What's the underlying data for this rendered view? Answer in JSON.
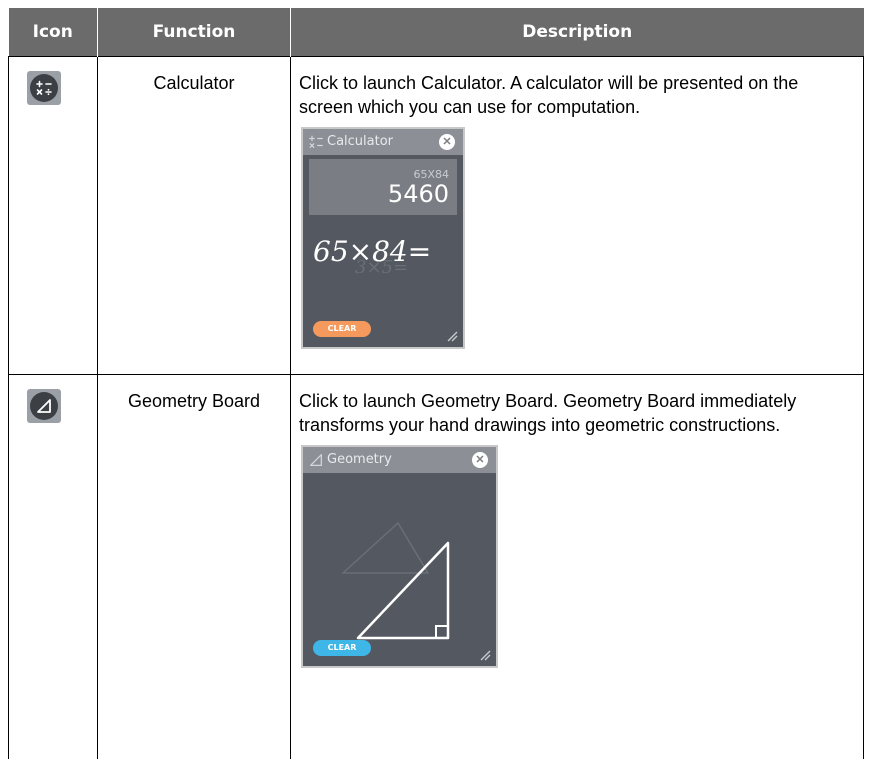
{
  "table": {
    "headers": {
      "icon": "Icon",
      "function": "Function",
      "description": "Description"
    },
    "rows": [
      {
        "icon": "calculator-icon",
        "function": "Calculator",
        "description": "Click to launch Calculator. A calculator will be presented on the screen which you can use for computation.",
        "screenshot": {
          "title": "Calculator",
          "expression": "65X84",
          "result": "5460",
          "handwriting": "65×84=",
          "faint_handwriting": "3×5=",
          "clear_label": "CLEAR",
          "clear_color": "#f59a5c"
        }
      },
      {
        "icon": "geometry-icon",
        "function": "Geometry Board",
        "description": "Click to launch Geometry Board. Geometry Board immediately transforms your hand drawings into geometric constructions.",
        "screenshot": {
          "title": "Geometry",
          "clear_label": "CLEAR",
          "clear_color": "#3fb6e8"
        }
      }
    ]
  },
  "colors": {
    "header_bg": "#6b6b6b",
    "panel_bg": "#545961",
    "panel_header": "#8c9096"
  }
}
